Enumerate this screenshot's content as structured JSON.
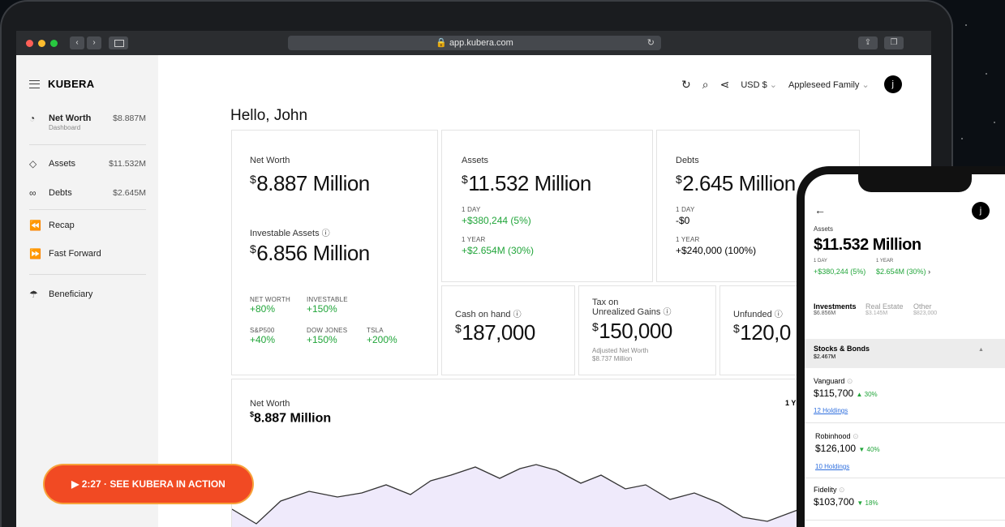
{
  "browser": {
    "url": "app.kubera.com"
  },
  "sidebar": {
    "logo": "KUBERA",
    "net_worth": {
      "label": "Net Worth",
      "sub": "Dashboard",
      "value": "$8.887M"
    },
    "assets": {
      "label": "Assets",
      "value": "$11.532M"
    },
    "debts": {
      "label": "Debts",
      "value": "$2.645M"
    },
    "recap": "Recap",
    "fast_forward": "Fast Forward",
    "beneficiary": "Beneficiary"
  },
  "topbar": {
    "currency": "USD $",
    "portfolio": "Appleseed Family",
    "avatar": "j"
  },
  "greeting": "Hello, John",
  "net_worth_card": {
    "label": "Net Worth",
    "currency": "$",
    "value": "8.887 Million",
    "investable_label": "Investable Assets",
    "investable_value": "6.856 Million",
    "stats": [
      {
        "label": "NET WORTH",
        "value": "+80%"
      },
      {
        "label": "INVESTABLE",
        "value": "+150%"
      },
      {
        "label": "S&P500",
        "value": "+40%"
      },
      {
        "label": "DOW JONES",
        "value": "+150%"
      },
      {
        "label": "TSLA",
        "value": "+200%"
      }
    ]
  },
  "assets_card": {
    "label": "Assets",
    "currency": "$",
    "value": "11.532 Million",
    "day_label": "1 DAY",
    "day_value": "+$380,244 (5%)",
    "year_label": "1 YEAR",
    "year_value": "+$2.654M (30%)"
  },
  "debts_card": {
    "label": "Debts",
    "currency": "$",
    "value": "2.645 Million",
    "day_label": "1 DAY",
    "day_value": "-$0",
    "year_label": "1 YEAR",
    "year_value": "+$240,000 (100%)"
  },
  "cash_card": {
    "label": "Cash on hand",
    "currency": "$",
    "value": "187,000"
  },
  "tax_card": {
    "label_line1": "Tax on",
    "label_line2": "Unrealized Gains",
    "currency": "$",
    "value": "150,000",
    "note_line1": "Adjusted Net Worth",
    "note_line2": "$8.737 Million"
  },
  "unfunded_card": {
    "label": "Unfunded",
    "currency": "$",
    "value": "120,0"
  },
  "chart_card": {
    "label": "Net Worth",
    "currency": "$",
    "value": "8.887 Million",
    "range": "1 YE"
  },
  "cta": {
    "label": "▶ 2:27 · SEE KUBERA IN ACTION"
  },
  "phone": {
    "avatar": "j",
    "title": "Assets",
    "value": "$11.532 Million",
    "day_label": "1 DAY",
    "day_value": "+$380,244 (5%)",
    "year_label": "1 YEAR",
    "year_value": "$2.654M (30%)",
    "tabs": [
      {
        "label": "Investments",
        "value": "$6.856M"
      },
      {
        "label": "Real Estate",
        "value": "$3.145M"
      },
      {
        "label": "Other",
        "value": "$823,000"
      }
    ],
    "section": {
      "label": "Stocks & Bonds",
      "value": "$2.467M"
    },
    "holdings": [
      {
        "name": "Vanguard",
        "value": "$115,700",
        "change": "30%",
        "link": "12 Holdings"
      },
      {
        "name": "Robinhood",
        "value": "$126,100",
        "change": "40%",
        "link": "10 Holdings"
      },
      {
        "name": "Fidelity",
        "value": "$103,700",
        "change": "18%",
        "link": ""
      }
    ]
  },
  "colors": {
    "accent_green": "#21a53a",
    "cta_orange": "#f14a23",
    "chart_fill": "#efeafb",
    "chart_line": "#333333"
  }
}
